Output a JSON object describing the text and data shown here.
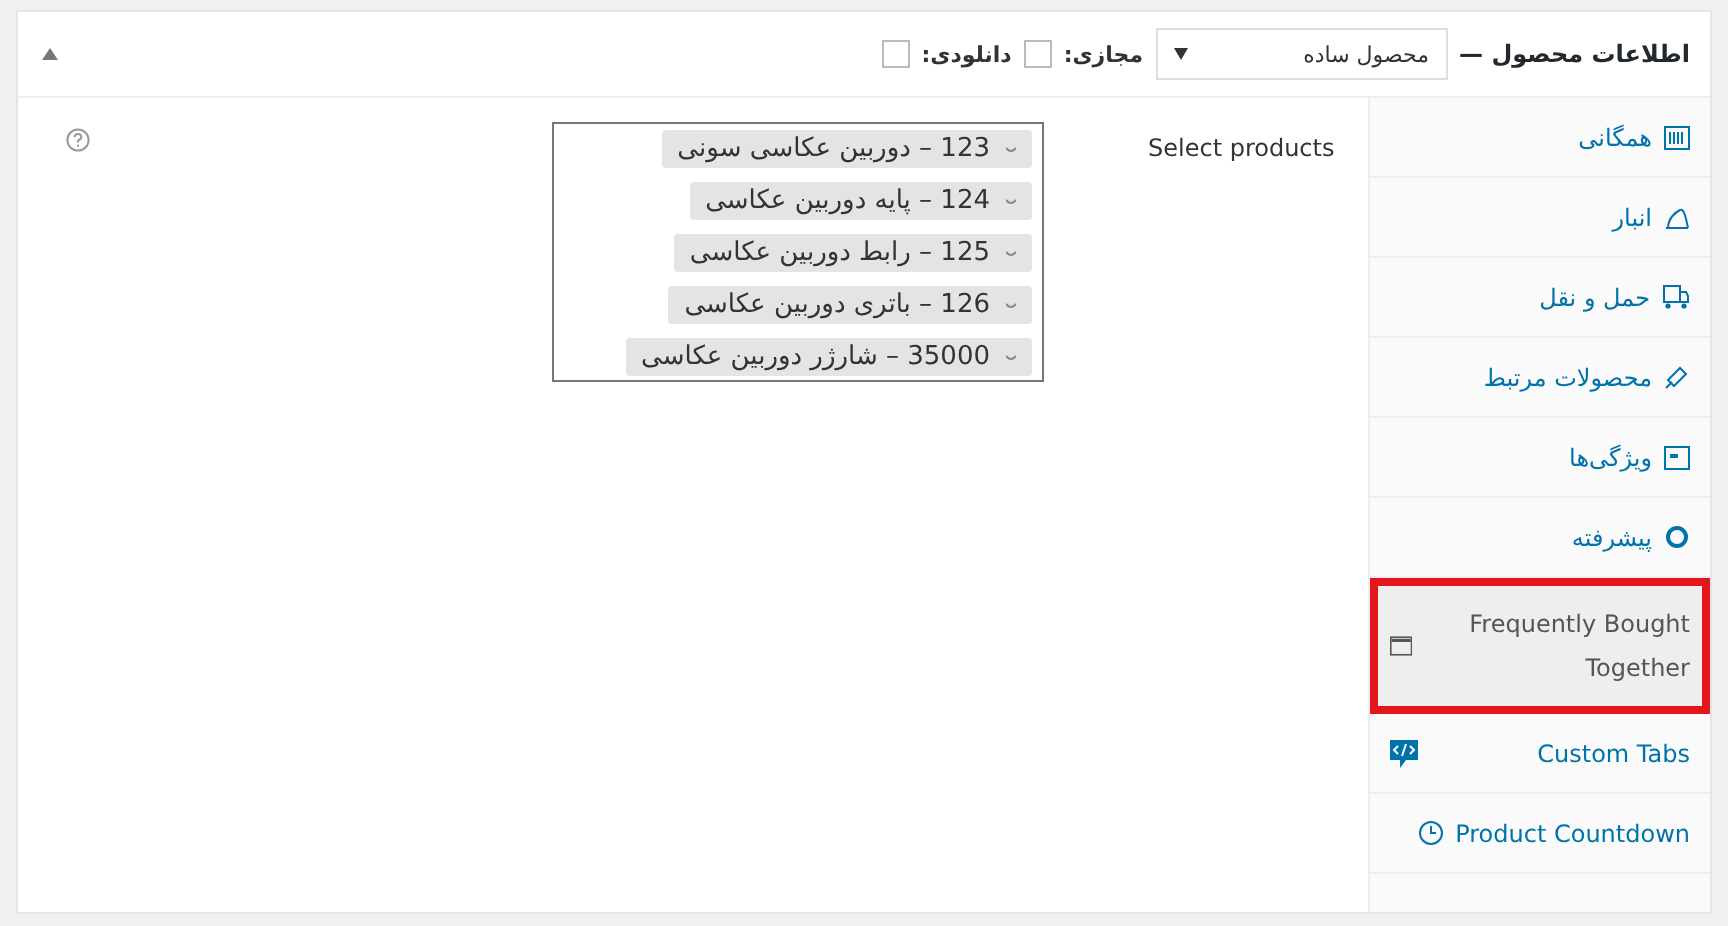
{
  "header": {
    "title": "اطلاعات محصول —",
    "product_type": "محصول ساده",
    "options": [
      {
        "label": "مجازی:",
        "checked": false
      },
      {
        "label": "دانلودی:",
        "checked": false
      }
    ],
    "expanded": true
  },
  "tabs": [
    {
      "label": "همگانی",
      "kind": "builtin",
      "selected": false,
      "highlighted": false
    },
    {
      "label": "انبار",
      "kind": "builtin",
      "selected": false,
      "highlighted": false
    },
    {
      "label": "حمل و نقل",
      "kind": "builtin",
      "selected": false,
      "highlighted": false
    },
    {
      "label": "محصولات مرتبط",
      "kind": "builtin",
      "selected": false,
      "highlighted": false
    },
    {
      "label": "ویژگی‌ها",
      "kind": "builtin",
      "selected": false,
      "highlighted": false
    },
    {
      "label": "پیشرفته",
      "kind": "builtin",
      "selected": false,
      "highlighted": false
    },
    {
      "label": "Frequently Bought Together",
      "kind": "addon",
      "selected": true,
      "highlighted": true
    },
    {
      "label": "Custom Tabs",
      "kind": "addon-spread",
      "selected": false,
      "highlighted": false
    },
    {
      "label": "Product Countdown",
      "kind": "addon",
      "selected": false,
      "highlighted": false
    }
  ],
  "field": {
    "label": "Select products",
    "products": [
      "123 – دوربین عکاسی سونی",
      "124 – پایه دوربین عکاسی",
      "125 – رابط دوربین عکاسی",
      "126 – باتری دوربین عکاسی",
      "35000 – شارژر دوربین عکاسی"
    ]
  }
}
